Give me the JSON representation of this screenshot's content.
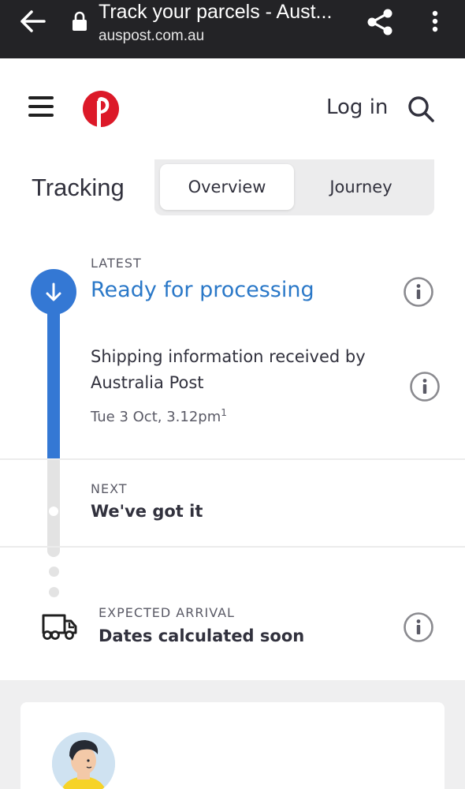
{
  "browser": {
    "title": "Track your parcels - Aust...",
    "url": "auspost.com.au",
    "icons": [
      "back-arrow-icon",
      "lock-icon",
      "share-icon",
      "more-vert-icon"
    ]
  },
  "header": {
    "login_label": "Log in",
    "icons": [
      "hamburger-menu-icon",
      "auspost-logo",
      "search-icon"
    ],
    "brand_color": "#dc1928"
  },
  "tracking": {
    "title": "Tracking",
    "tabs": [
      {
        "label": "Overview",
        "active": true
      },
      {
        "label": "Journey",
        "active": false
      }
    ],
    "latest": {
      "eyebrow": "LATEST",
      "status": "Ready for processing",
      "description": "Shipping information received by Australia Post",
      "date": "Tue 3 Oct, 3.12pm",
      "footnote": "1"
    },
    "next": {
      "eyebrow": "NEXT",
      "status": "We've got it"
    },
    "arrival": {
      "eyebrow": "EXPECTED ARRIVAL",
      "status": "Dates calculated soon"
    },
    "colors": {
      "accent": "#3478d4",
      "track_grey": "#e3e3e3"
    }
  }
}
